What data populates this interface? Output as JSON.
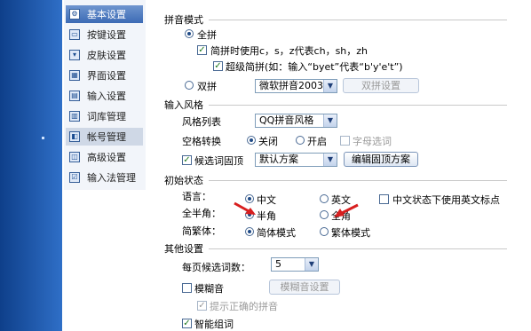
{
  "nav": {
    "items": [
      {
        "label": "基本设置",
        "icon": "wrench-icon",
        "glyph": "⚙"
      },
      {
        "label": "按键设置",
        "icon": "keyboard-icon",
        "glyph": "▭"
      },
      {
        "label": "皮肤设置",
        "icon": "shirt-icon",
        "glyph": "▾"
      },
      {
        "label": "界面设置",
        "icon": "window-icon",
        "glyph": "▦"
      },
      {
        "label": "输入设置",
        "icon": "input-icon",
        "glyph": "▤"
      },
      {
        "label": "词库管理",
        "icon": "dictionary-icon",
        "glyph": "▥"
      },
      {
        "label": "帐号管理",
        "icon": "account-icon",
        "glyph": "◧"
      },
      {
        "label": "高级设置",
        "icon": "advanced-icon",
        "glyph": "◫"
      },
      {
        "label": "输入法管理",
        "icon": "ime-manage-icon",
        "glyph": "☑"
      }
    ]
  },
  "pinyin": {
    "group_title": "拼音模式",
    "full_label": "全拼",
    "simple_label": "简拼时使用c，s，z代表ch，sh，zh",
    "super_label": "超级简拼(如：输入“byet”代表“b'y'e't”)",
    "double_label": "双拼",
    "double_scheme": "微软拼音2003",
    "double_button": "双拼设置"
  },
  "style": {
    "group_title": "输入风格",
    "list_label": "风格列表",
    "list_value": "QQ拼音风格",
    "space_label": "空格转换",
    "off_label": "关闭",
    "on_label": "开启",
    "letter_label": "字母选词",
    "fixed_label": "候选词固顶",
    "fixed_value": "默认方案",
    "fixed_button": "编辑固顶方案"
  },
  "init": {
    "group_title": "初始状态",
    "lang_label": "语言：",
    "cn_label": "中文",
    "en_label": "英文",
    "en_punct_label": "中文状态下使用英文标点",
    "width_label": "全半角：",
    "half_label": "半角",
    "full_label": "全角",
    "script_label": "简繁体：",
    "simp_label": "简体模式",
    "trad_label": "繁体模式"
  },
  "other": {
    "group_title": "其他设置",
    "per_page_label": "每页候选词数：",
    "per_page_value": "5",
    "fuzzy_label": "模糊音",
    "fuzzy_button": "模糊音设置",
    "hint_label": "提示正确的拼音",
    "smart_label": "智能组词"
  },
  "colors": {
    "accent": "#3c6bb5",
    "sidebar": "#1a4f9e",
    "annotation_arrow": "#d81f1f"
  }
}
